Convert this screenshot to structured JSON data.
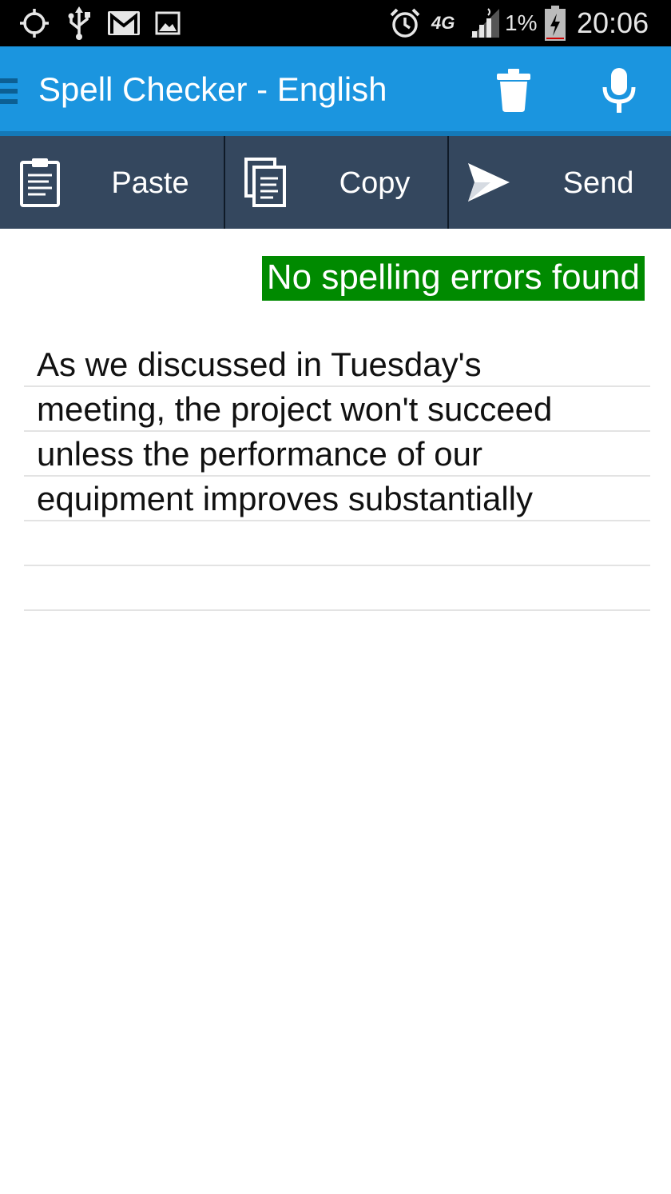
{
  "status_bar": {
    "icons_left": [
      "gps-icon",
      "usb-icon",
      "gmail-icon",
      "gallery-icon"
    ],
    "icons_right": [
      "alarm-icon",
      "network-4g-icon",
      "signal-icon",
      "battery-charging-icon"
    ],
    "network_label": "4G",
    "battery_percent": "1%",
    "time": "20:06"
  },
  "app_bar": {
    "title": "Spell Checker - English",
    "actions": [
      "trash-icon",
      "microphone-icon"
    ],
    "color": "#1b95df"
  },
  "toolbar": {
    "paste_label": "Paste",
    "copy_label": "Copy",
    "send_label": "Send",
    "color": "#34475e"
  },
  "result": {
    "message": "No spelling errors found",
    "color": "#008a00"
  },
  "editor": {
    "lines": [
      "As we discussed in Tuesday's",
      "meeting, the project won't succeed",
      "unless the performance of our",
      "equipment improves substantially",
      "",
      ""
    ]
  }
}
